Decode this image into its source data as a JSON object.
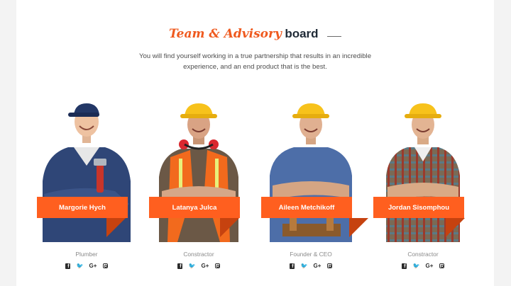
{
  "section": {
    "title_accent": "Team & Advisory",
    "title_rest": "board",
    "intro": "You will find yourself working in a true partnership that results in an incredible experience, and an end product that is the best."
  },
  "colors": {
    "accent": "#ef5a1f",
    "nameplate": "#ff5f1f",
    "nameplate_shadow": "#c6420f"
  },
  "team": [
    {
      "name": "Margorie Hych",
      "role": "Plumber",
      "photo_icon": "plumber-photo",
      "socials": [
        "facebook-icon",
        "twitter-icon",
        "google-plus-icon",
        "instagram-icon"
      ]
    },
    {
      "name": "Latanya Julca",
      "role": "Constractor",
      "photo_icon": "construction-worker-photo",
      "socials": [
        "facebook-icon",
        "twitter-icon",
        "google-plus-icon",
        "instagram-icon"
      ]
    },
    {
      "name": "Aileen Metchikoff",
      "role": "Founder & CEO",
      "photo_icon": "worker-photo",
      "socials": [
        "facebook-icon",
        "twitter-icon",
        "google-plus-icon",
        "instagram-icon"
      ]
    },
    {
      "name": "Jordan Sisomphou",
      "role": "Constractor",
      "photo_icon": "worker-photo",
      "socials": [
        "facebook-icon",
        "twitter-icon",
        "google-plus-icon",
        "instagram-icon"
      ]
    }
  ],
  "social_glyphs": {
    "twitter": "🐦",
    "google_plus": "G+"
  }
}
